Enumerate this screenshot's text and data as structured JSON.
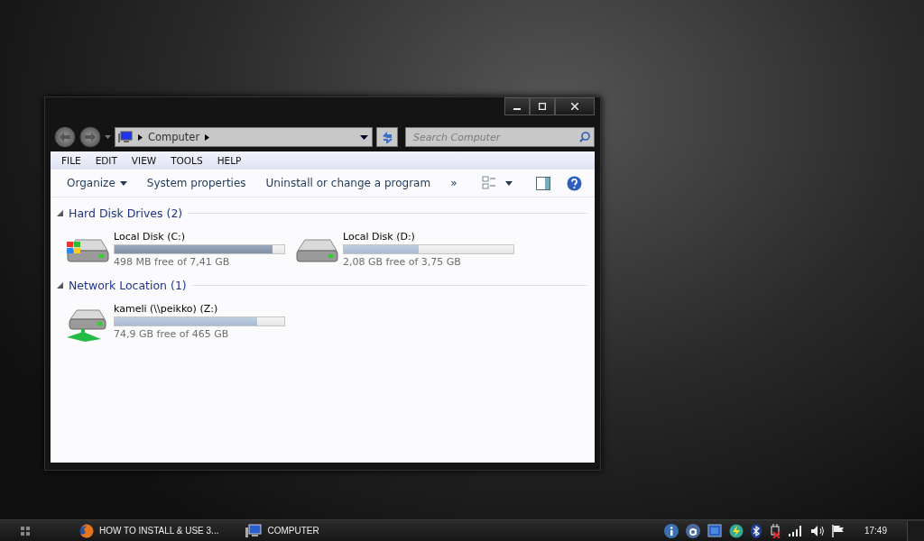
{
  "window": {
    "address": {
      "location": "Computer"
    },
    "search": {
      "placeholder": "Search Computer"
    },
    "menu": [
      "FILE",
      "EDIT",
      "VIEW",
      "TOOLS",
      "HELP"
    ],
    "commands": [
      {
        "label": "Organize",
        "kind": "dropdown"
      },
      {
        "label": "System properties",
        "kind": "plain"
      },
      {
        "label": "Uninstall or change a program",
        "kind": "plain"
      },
      {
        "label": "»",
        "kind": "plain"
      }
    ],
    "groups": [
      {
        "title": "Hard Disk Drives (2)",
        "expanded": true,
        "drives": [
          {
            "name": "Local Disk (C:)",
            "kind": "system",
            "level": 0.93,
            "low_space": true,
            "free": "498 MB free of 7,41 GB"
          },
          {
            "name": "Local Disk (D:)",
            "kind": "local",
            "level": 0.44,
            "low_space": false,
            "free": "2,08 GB free of 3,75 GB"
          }
        ]
      },
      {
        "title": "Network Location (1)",
        "expanded": true,
        "drives": [
          {
            "name": "kameli (\\\\peikko) (Z:)",
            "kind": "network",
            "level": 0.84,
            "low_space": false,
            "free": "74,9 GB free of 465 GB"
          }
        ]
      }
    ]
  },
  "taskbar": {
    "tasks": [
      {
        "label": "HOW TO INSTALL & USE 3...",
        "kind": "browser"
      },
      {
        "label": "COMPUTER",
        "kind": "computer"
      }
    ],
    "clock": "17:49"
  }
}
